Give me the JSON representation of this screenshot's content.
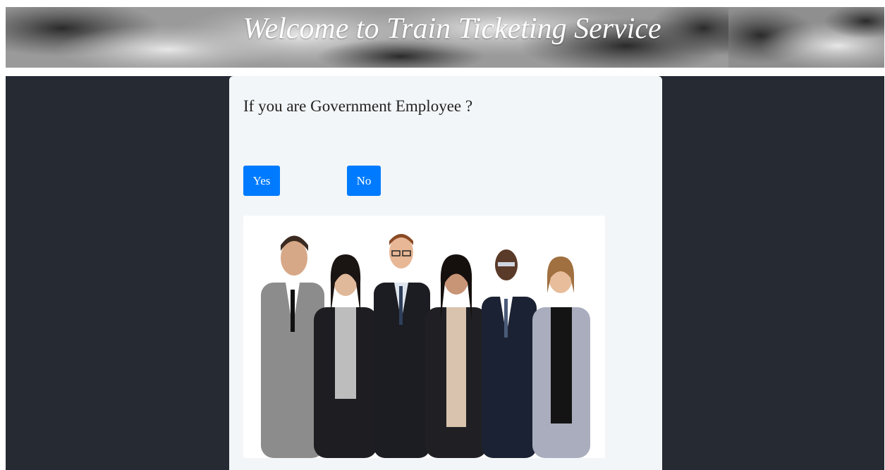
{
  "header": {
    "title": "Welcome to Train Ticketing Service"
  },
  "card": {
    "question": "If you are Government Employee ?",
    "yes_label": "Yes",
    "no_label": "No",
    "image_alt": "group-of-business-people-photo"
  },
  "colors": {
    "banner_bg": "#a8a8a8",
    "body_bg": "#262a33",
    "card_bg": "#f3f6f8",
    "button_bg": "#007bff",
    "button_text": "#ffffff"
  }
}
